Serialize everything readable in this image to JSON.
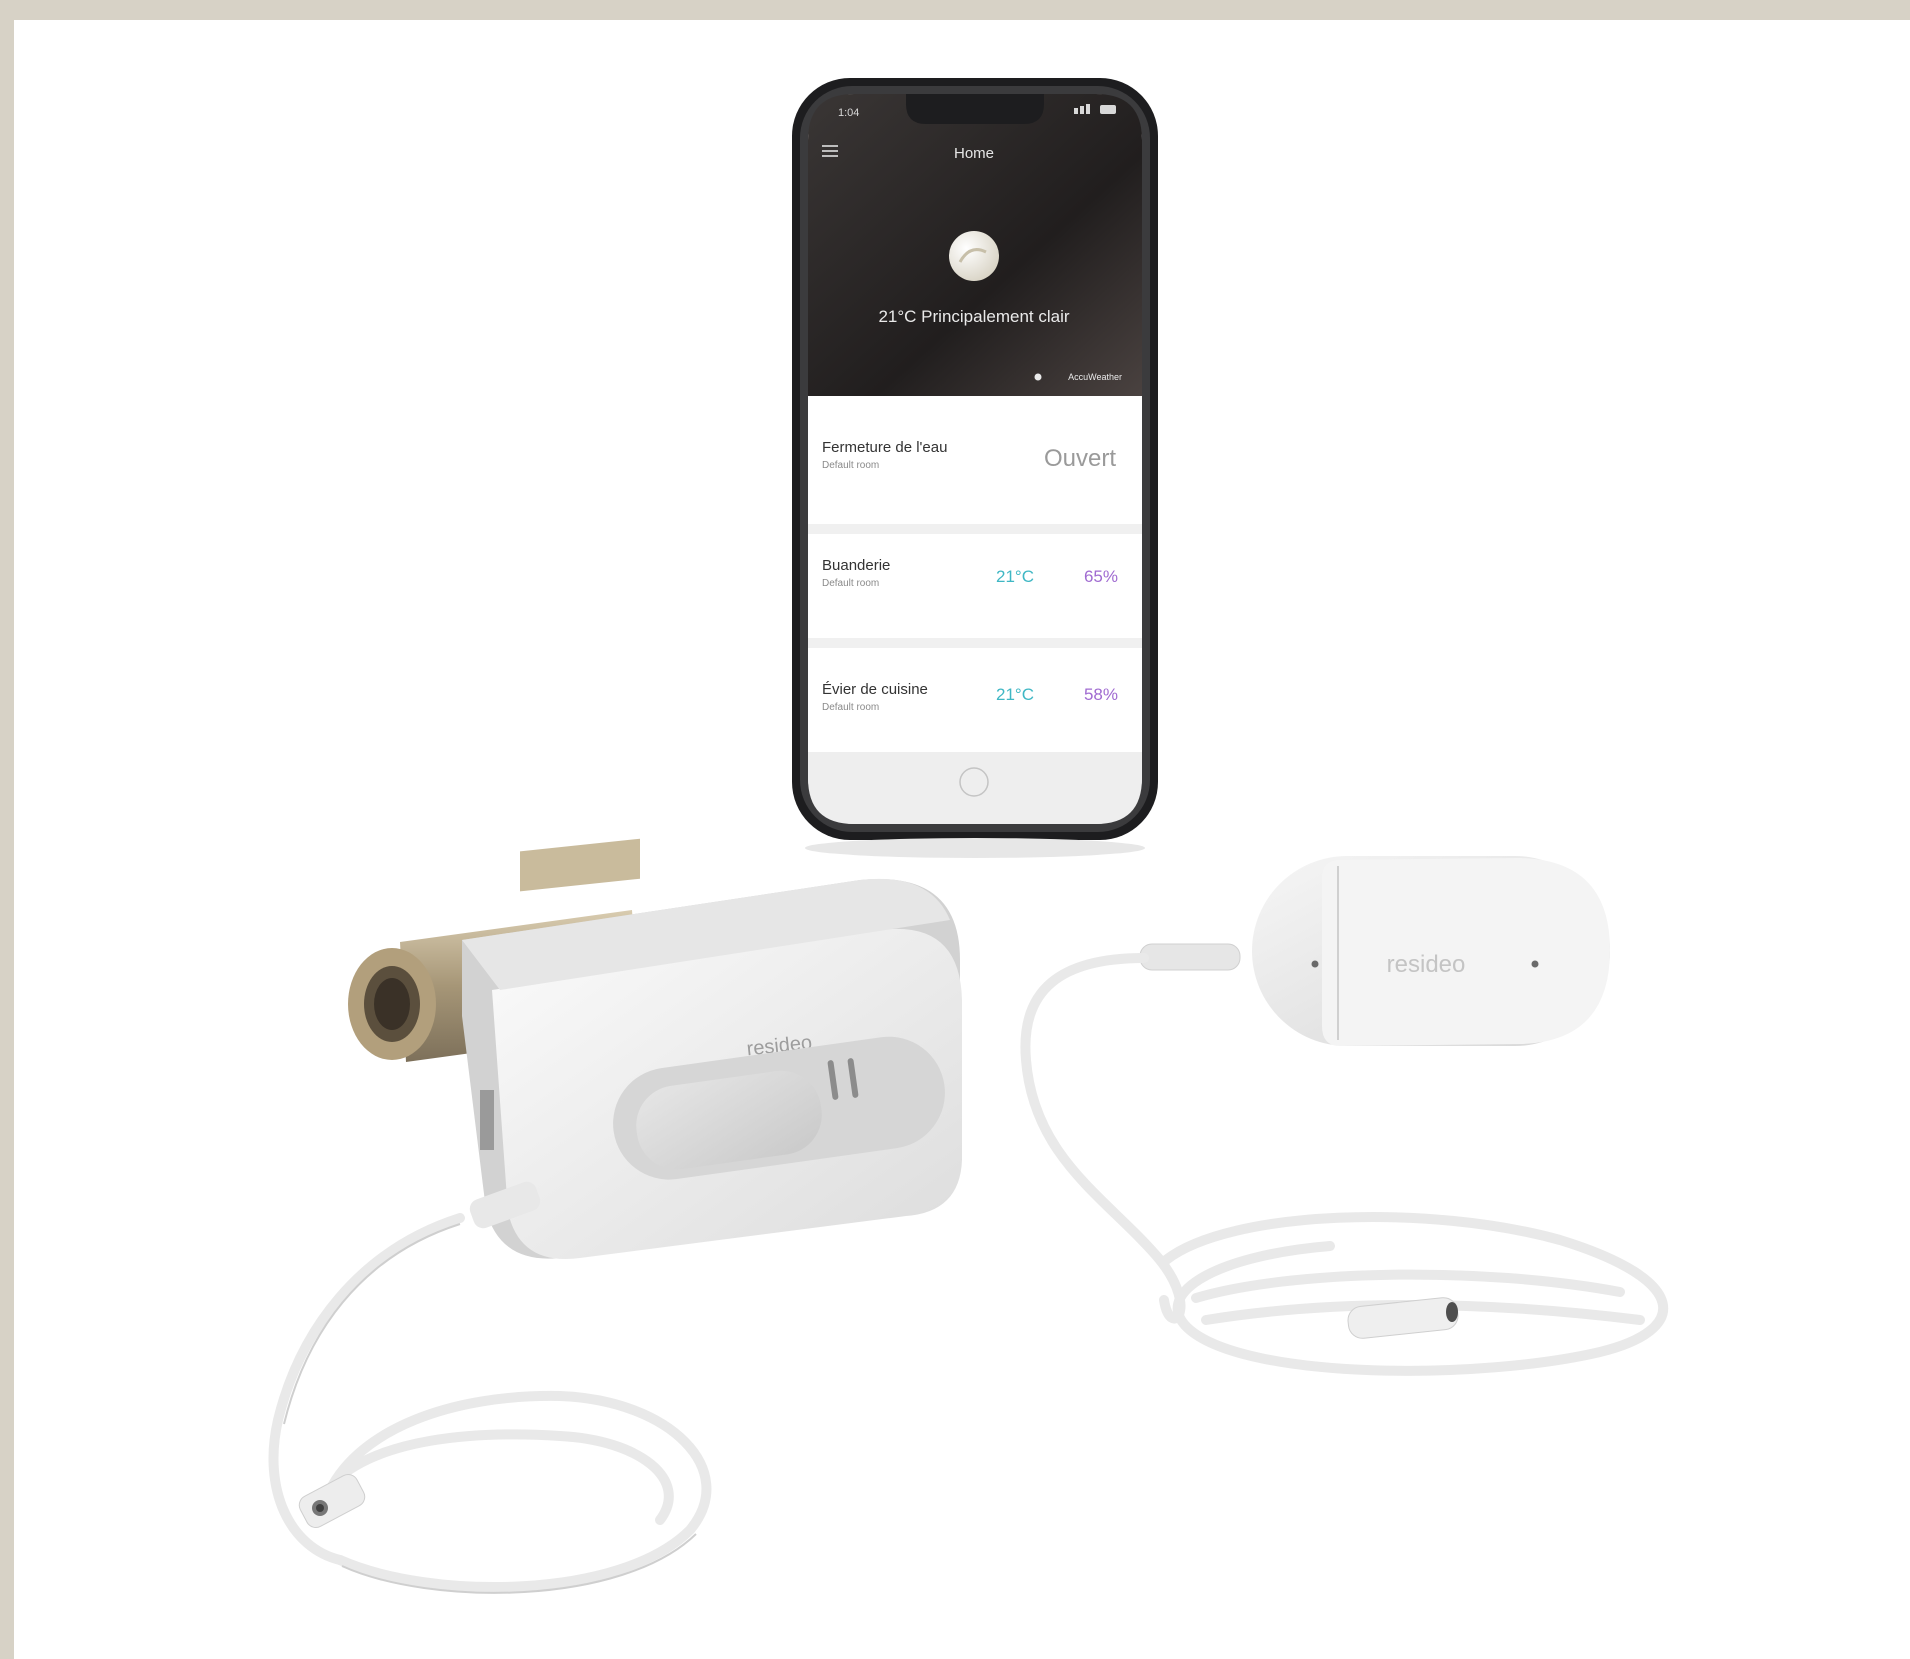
{
  "colors": {
    "backdrop": "#d7d2c6",
    "canvas": "#ffffff",
    "phone_frame": "#1d1d1f",
    "app_header": "#2a2625",
    "valve_body": "#efefef",
    "brass": "#b8a98a",
    "temp_teal": "#3fb7c4",
    "humidity_purple": "#a06bd1"
  },
  "phone": {
    "status_time": "1:04",
    "header_title": "Home",
    "weather_sublabel": "",
    "weather_text": "21°C Principalement clair",
    "weather_credit": "AccuWeather",
    "rows": [
      {
        "title": "Fermeture de l'eau",
        "subtitle": "Default room",
        "value": "Ouvert",
        "temp": "",
        "humidity": ""
      },
      {
        "title": "Buanderie",
        "subtitle": "Default room",
        "value": "",
        "temp": "21°C",
        "humidity": "65%"
      },
      {
        "title": "Évier de cuisine",
        "subtitle": "Default room",
        "value": "",
        "temp": "21°C",
        "humidity": "58%"
      }
    ]
  },
  "devices": {
    "valve_brand": "resideo",
    "sensor_brand": "resideo"
  }
}
